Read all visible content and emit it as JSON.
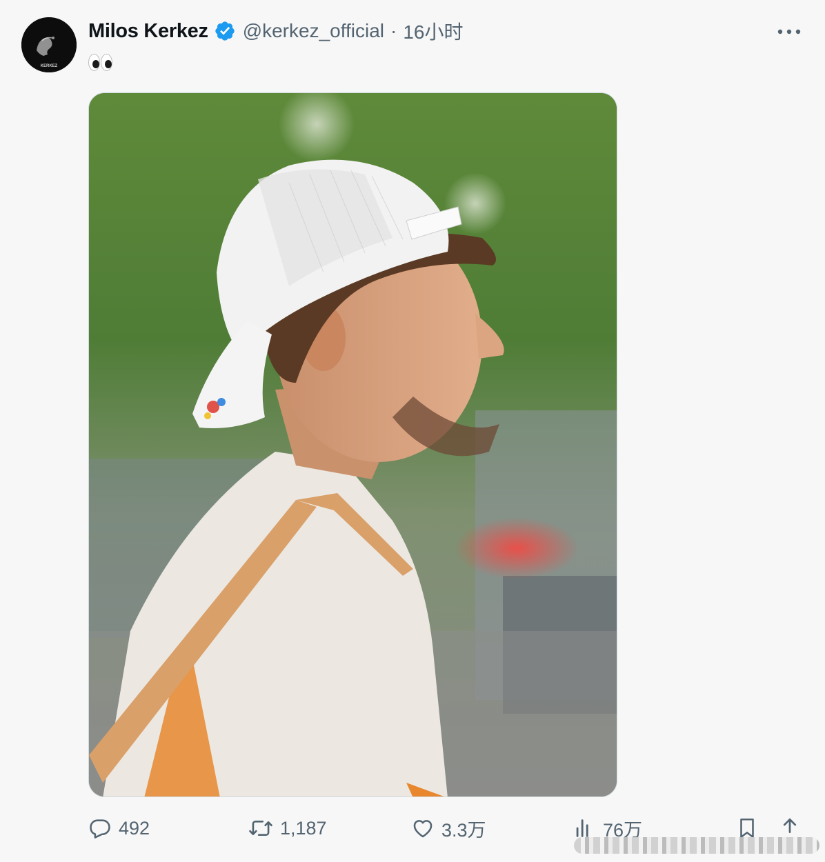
{
  "author": {
    "display_name": "Milos Kerkez",
    "handle": "@kerkez_official",
    "separator": "·",
    "timestamp": "16小时",
    "avatar_text": "KERKEZ",
    "verified": true
  },
  "tweet": {
    "text_emoji": "eyes-emoji"
  },
  "media": {
    "description_icon": "photo"
  },
  "actions": {
    "reply_count": "492",
    "retweet_count": "1,187",
    "like_count": "3.3万",
    "views_count": "76万"
  },
  "colors": {
    "verified_blue": "#1d9bf0",
    "secondary_text": "#536471",
    "primary_text": "#0f1419",
    "background": "#f7f7f7"
  }
}
